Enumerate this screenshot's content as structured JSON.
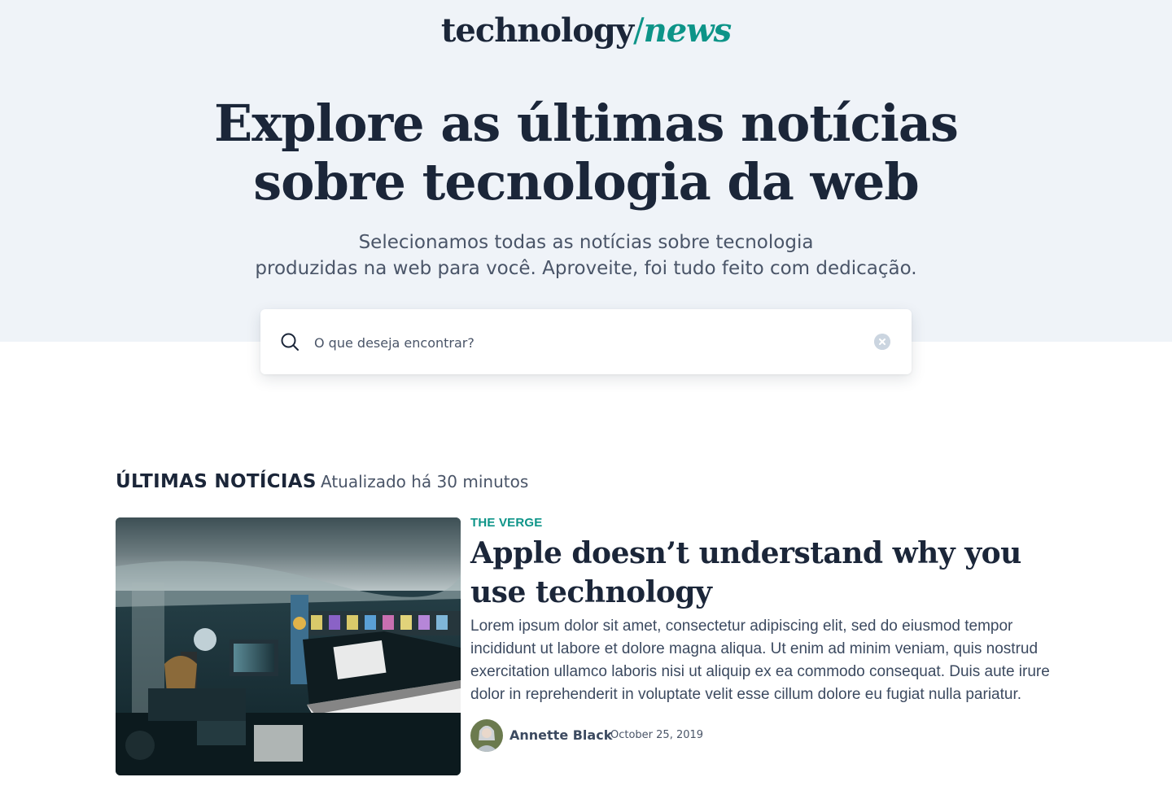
{
  "header": {
    "logo_main": "technology",
    "logo_slash": "/",
    "logo_accent": "news"
  },
  "hero": {
    "headline_line1": "Explore as últimas notícias",
    "headline_line2": "sobre tecnologia da web",
    "subtitle_line1": "Selecionamos todas as notícias sobre tecnologia",
    "subtitle_line2": "produzidas na web para você. Aproveite, foi tudo feito com dedicação."
  },
  "search": {
    "placeholder": "O que deseja encontrar?",
    "value": "",
    "icon": "search-icon",
    "clear_icon": "clear-icon"
  },
  "latest": {
    "title": "ÚLTIMAS NOTÍCIAS",
    "updated": "Atualizado há 30 minutos"
  },
  "article": {
    "source": "THE VERGE",
    "title": "Apple doesn’t understand why you use technology",
    "excerpt": "Lorem ipsum dolor sit amet, consectetur adipiscing elit, sed do eiusmod tempor incididunt ut labore et dolore magna aliqua. Ut enim ad minim veniam, quis nostrud exercitation ullamco laboris nisi ut aliquip ex ea commodo consequat. Duis aute irure dolor in reprehenderit in voluptate velit esse cillum dolore eu fugiat nulla pariatur.",
    "author": "Annette Black",
    "date": "October 25, 2019"
  },
  "colors": {
    "accent": "#0d9488",
    "text_dark": "#1b2639",
    "hero_bg": "#eff3f8"
  }
}
